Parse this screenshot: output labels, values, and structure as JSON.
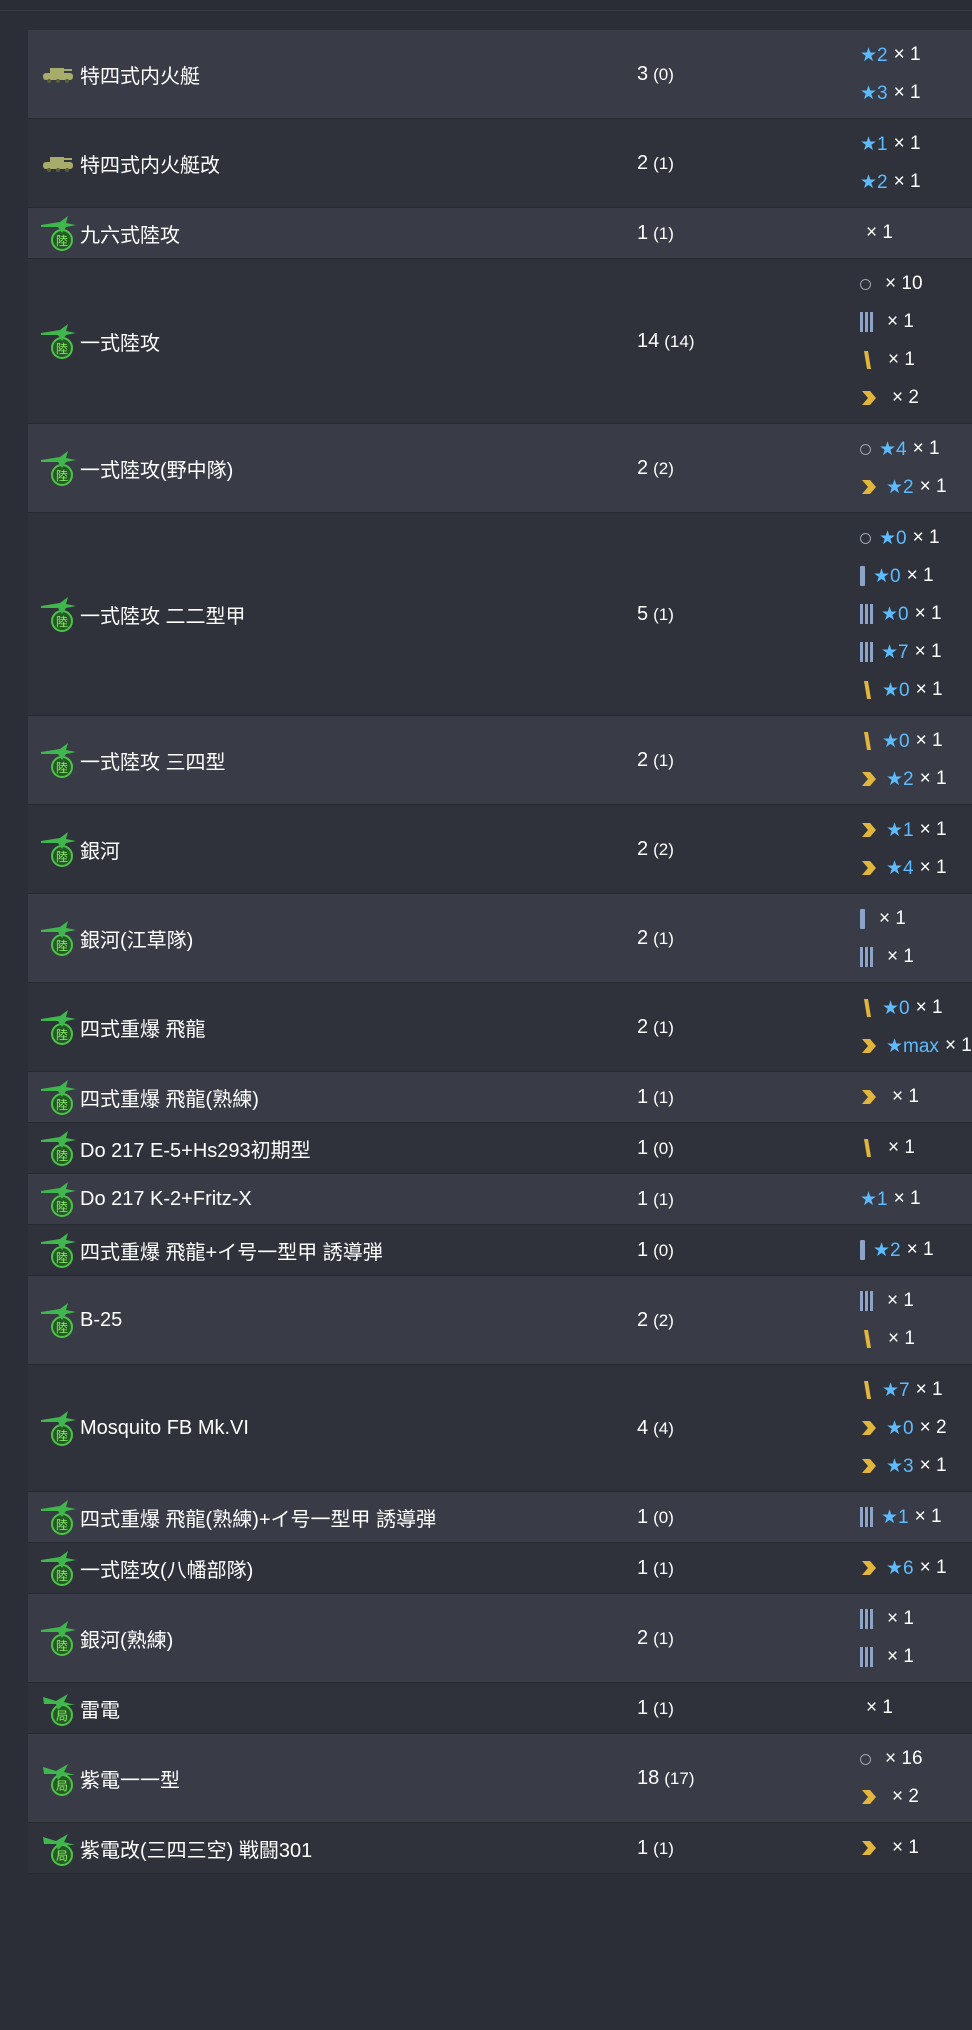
{
  "colors": {
    "bg": "#2b2e37",
    "row_odd": "#393c47",
    "row_even": "#2f323b",
    "star": "#5cbcff",
    "gold": "#e2b53c",
    "bar": "#8da4c8",
    "plane_green": "#3fb74c"
  },
  "rows": [
    {
      "icon": "ship-icon",
      "name": "特四式内火艇",
      "count": "3",
      "paren": "(0)",
      "prof": [
        {
          "g": "",
          "star": "★2",
          "m": "× 1"
        },
        {
          "g": "",
          "star": "★3",
          "m": "× 1"
        }
      ]
    },
    {
      "icon": "ship-icon",
      "name": "特四式内火艇改",
      "count": "2",
      "paren": "(1)",
      "prof": [
        {
          "g": "",
          "star": "★1",
          "m": "× 1"
        },
        {
          "g": "",
          "star": "★2",
          "m": "× 1"
        }
      ]
    },
    {
      "icon": "land-bomber-icon",
      "name": "九六式陸攻",
      "count": "1",
      "paren": "(1)",
      "prof": [
        {
          "g": "",
          "star": "",
          "m": "× 1"
        }
      ]
    },
    {
      "icon": "land-bomber-icon",
      "name": "一式陸攻",
      "count": "14",
      "paren": "(14)",
      "prof": [
        {
          "g": "circle",
          "star": "",
          "m": "× 10"
        },
        {
          "g": "bar3",
          "star": "",
          "m": "× 1"
        },
        {
          "g": "slash",
          "star": "",
          "m": "× 1"
        },
        {
          "g": "chev",
          "star": "",
          "m": "× 2"
        }
      ]
    },
    {
      "icon": "land-bomber-icon",
      "name": "一式陸攻(野中隊)",
      "count": "2",
      "paren": "(2)",
      "prof": [
        {
          "g": "circle",
          "star": "★4",
          "m": "× 1"
        },
        {
          "g": "chev",
          "star": "★2",
          "m": "× 1"
        }
      ]
    },
    {
      "icon": "land-bomber-icon",
      "name": "一式陸攻 二二型甲",
      "count": "5",
      "paren": "(1)",
      "prof": [
        {
          "g": "circle",
          "star": "★0",
          "m": "× 1"
        },
        {
          "g": "bar1",
          "star": "★0",
          "m": "× 1"
        },
        {
          "g": "bar3",
          "star": "★0",
          "m": "× 1"
        },
        {
          "g": "bar3",
          "star": "★7",
          "m": "× 1"
        },
        {
          "g": "slash",
          "star": "★0",
          "m": "× 1"
        }
      ]
    },
    {
      "icon": "land-bomber-icon",
      "name": "一式陸攻 三四型",
      "count": "2",
      "paren": "(1)",
      "prof": [
        {
          "g": "slash",
          "star": "★0",
          "m": "× 1"
        },
        {
          "g": "chev",
          "star": "★2",
          "m": "× 1"
        }
      ]
    },
    {
      "icon": "land-bomber-icon",
      "name": "銀河",
      "count": "2",
      "paren": "(2)",
      "prof": [
        {
          "g": "chev",
          "star": "★1",
          "m": "× 1"
        },
        {
          "g": "chev",
          "star": "★4",
          "m": "× 1"
        }
      ]
    },
    {
      "icon": "land-bomber-icon",
      "name": "銀河(江草隊)",
      "count": "2",
      "paren": "(1)",
      "prof": [
        {
          "g": "bar1",
          "star": "",
          "m": "× 1"
        },
        {
          "g": "bar3",
          "star": "",
          "m": "× 1"
        }
      ]
    },
    {
      "icon": "land-bomber-icon",
      "name": "四式重爆 飛龍",
      "count": "2",
      "paren": "(1)",
      "prof": [
        {
          "g": "slash",
          "star": "★0",
          "m": "× 1"
        },
        {
          "g": "chev",
          "star": "★max",
          "m": "× 1"
        }
      ]
    },
    {
      "icon": "land-bomber-icon",
      "name": "四式重爆 飛龍(熟練)",
      "count": "1",
      "paren": "(1)",
      "prof": [
        {
          "g": "chev",
          "star": "",
          "m": "× 1"
        }
      ]
    },
    {
      "icon": "land-bomber-icon",
      "name": "Do 217 E-5+Hs293初期型",
      "count": "1",
      "paren": "(0)",
      "prof": [
        {
          "g": "slash",
          "star": "",
          "m": "× 1"
        }
      ]
    },
    {
      "icon": "land-bomber-icon",
      "name": "Do 217 K-2+Fritz-X",
      "count": "1",
      "paren": "(1)",
      "prof": [
        {
          "g": "",
          "star": "★1",
          "m": "× 1"
        }
      ]
    },
    {
      "icon": "land-bomber-icon",
      "name": "四式重爆 飛龍+イ号一型甲 誘導弾",
      "count": "1",
      "paren": "(0)",
      "prof": [
        {
          "g": "bar1",
          "star": "★2",
          "m": "× 1"
        }
      ]
    },
    {
      "icon": "land-bomber-icon",
      "name": "B-25",
      "count": "2",
      "paren": "(2)",
      "prof": [
        {
          "g": "bar3",
          "star": "",
          "m": "× 1"
        },
        {
          "g": "slash",
          "star": "",
          "m": "× 1"
        }
      ]
    },
    {
      "icon": "land-bomber-icon",
      "name": "Mosquito FB Mk.VI",
      "count": "4",
      "paren": "(4)",
      "prof": [
        {
          "g": "slash",
          "star": "★7",
          "m": "× 1"
        },
        {
          "g": "chev",
          "star": "★0",
          "m": "× 2"
        },
        {
          "g": "chev",
          "star": "★3",
          "m": "× 1"
        }
      ]
    },
    {
      "icon": "land-bomber-icon",
      "name": "四式重爆 飛龍(熟練)+イ号一型甲 誘導弾",
      "count": "1",
      "paren": "(0)",
      "prof": [
        {
          "g": "bar3",
          "star": "★1",
          "m": "× 1"
        }
      ]
    },
    {
      "icon": "land-bomber-icon",
      "name": "一式陸攻(八幡部隊)",
      "count": "1",
      "paren": "(1)",
      "prof": [
        {
          "g": "chev",
          "star": "★6",
          "m": "× 1"
        }
      ]
    },
    {
      "icon": "land-bomber-icon",
      "name": "銀河(熟練)",
      "count": "2",
      "paren": "(1)",
      "prof": [
        {
          "g": "bar3",
          "star": "",
          "m": "× 1"
        },
        {
          "g": "bar3",
          "star": "",
          "m": "× 1"
        }
      ]
    },
    {
      "icon": "interceptor-icon",
      "name": "雷電",
      "count": "1",
      "paren": "(1)",
      "prof": [
        {
          "g": "",
          "star": "",
          "m": "× 1"
        }
      ]
    },
    {
      "icon": "interceptor-icon",
      "name": "紫電一一型",
      "count": "18",
      "paren": "(17)",
      "prof": [
        {
          "g": "circle",
          "star": "",
          "m": "× 16"
        },
        {
          "g": "chev",
          "star": "",
          "m": "× 2"
        }
      ]
    },
    {
      "icon": "interceptor-icon",
      "name": "紫電改(三四三空) 戦闘301",
      "count": "1",
      "paren": "(1)",
      "prof": [
        {
          "g": "chev",
          "star": "",
          "m": "× 1"
        }
      ]
    }
  ]
}
